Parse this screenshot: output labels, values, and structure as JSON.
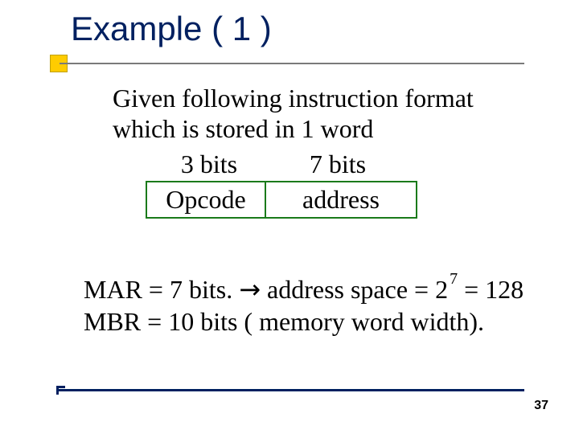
{
  "title": "Example ( 1 )",
  "body": {
    "line1": "Given following instruction format",
    "line2": "which is stored in 1  word"
  },
  "format": {
    "bits3": "3 bits",
    "bits7": "7 bits",
    "opcode": "Opcode",
    "address": "address"
  },
  "calc": {
    "mar_prefix": "MAR = 7 bits. ",
    "arrow": "→",
    "mar_mid": " address space = 2",
    "exp": "7",
    "mar_suffix": "  = 128",
    "mbr": "MBR = 10 bits ( memory word width)."
  },
  "page": "37"
}
